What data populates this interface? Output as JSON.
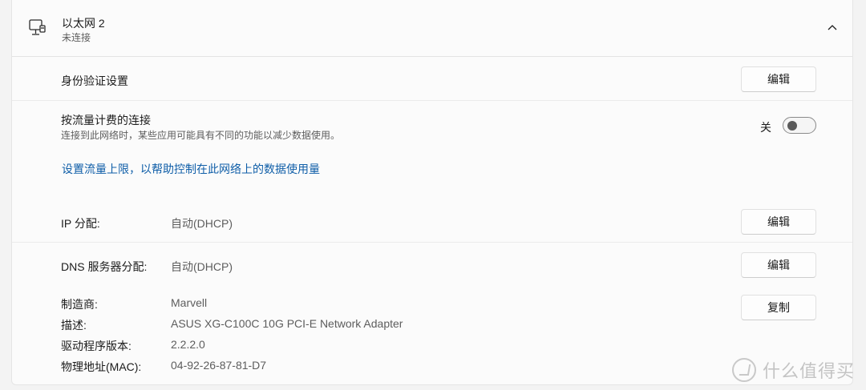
{
  "header": {
    "title": "以太网 2",
    "subtitle": "未连接",
    "icon": "wired-network-icon",
    "expand_icon": "chevron-up-icon"
  },
  "auth": {
    "label": "身份验证设置",
    "button": "编辑"
  },
  "metered": {
    "label": "按流量计费的连接",
    "description": "连接到此网络时，某些应用可能具有不同的功能以减少数据使用。",
    "toggle_state": "关",
    "toggle_on": false,
    "link": "设置流量上限，以帮助控制在此网络上的数据使用量"
  },
  "ip": {
    "label": "IP 分配:",
    "value": "自动(DHCP)",
    "button": "编辑"
  },
  "dns": {
    "label": "DNS 服务器分配:",
    "value": "自动(DHCP)",
    "button": "编辑"
  },
  "properties": {
    "copy_button": "复制",
    "items": [
      {
        "label": "制造商:",
        "value": "Marvell"
      },
      {
        "label": "描述:",
        "value": "ASUS XG-C100C 10G PCI-E Network Adapter"
      },
      {
        "label": "驱动程序版本:",
        "value": "2.2.2.0"
      },
      {
        "label": "物理地址(MAC):",
        "value": "04-92-26-87-81-D7"
      }
    ]
  },
  "watermark": {
    "text": "什么值得买"
  }
}
